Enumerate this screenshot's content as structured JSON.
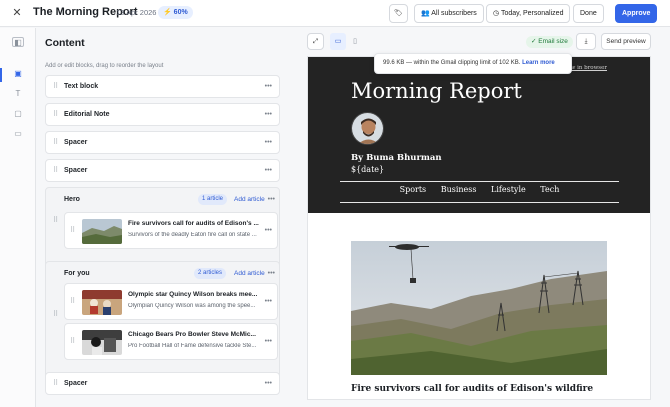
{
  "header": {
    "close_icon": "close-icon",
    "title": "The Morning Report",
    "date": "13 Apr 2026",
    "score": "60%",
    "buttons": {
      "all_subscribers": "All subscribers",
      "schedule": "Today, Personalized",
      "done": "Done",
      "approve": "Approve"
    }
  },
  "rail": {
    "icons": [
      "sidebar-toggle-icon",
      "blocks-icon",
      "text-icon",
      "layout-icon",
      "page-icon"
    ]
  },
  "content": {
    "title": "Content",
    "hint": "Add or edit blocks, drag to reorder the layout",
    "blocks_top": [
      "Text block",
      "Editorial Note",
      "Spacer",
      "Spacer"
    ],
    "hero": {
      "label": "Hero",
      "count": "1 article",
      "add": "Add article",
      "articles": [
        {
          "title": "Fire survivors call for audits of Edison's ...",
          "sub": "Survivors of the deadly Eaton fire call on state ..."
        }
      ]
    },
    "for_you": {
      "label": "For you",
      "count": "2 articles",
      "add": "Add article",
      "articles": [
        {
          "title": "Olympic star Quincy Wilson breaks mee...",
          "sub": "Olympian Quincy Wilson was among the spee..."
        },
        {
          "title": "Chicago Bears Pro Bowler Steve McMic...",
          "sub": "Pro Football Hall of Fame defensive tackle Ste..."
        }
      ]
    },
    "blocks_bottom": [
      "Spacer"
    ]
  },
  "preview": {
    "send_preview": "Send preview",
    "email_size": "Email size",
    "tooltip_text": "99.6 KB — within the Gmail clipping limit of 102 KB.",
    "tooltip_link": "Learn more",
    "view_in_browser": "View in browser",
    "brand": "Morning Report",
    "byline": "By Buma Bhurman",
    "date_placeholder": "${date}",
    "nav": [
      "Sports",
      "Business",
      "Lifestyle",
      "Tech"
    ],
    "headline": "Fire survivors call for audits of Edison's wildfire"
  },
  "colors": {
    "accent": "#3366e8",
    "hero_bg": "#232323",
    "success": "#1f7a3a"
  }
}
